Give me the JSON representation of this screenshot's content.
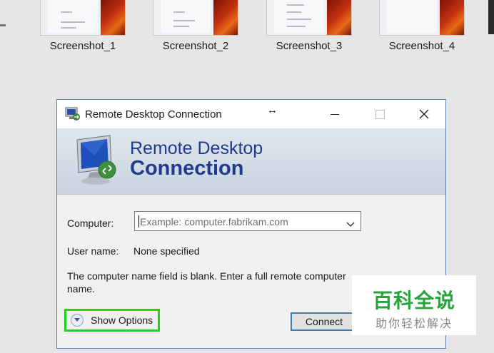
{
  "explorer": {
    "thumbnails": [
      {
        "name": "Screenshot_1"
      },
      {
        "name": "Screenshot_2"
      },
      {
        "name": "Screenshot_3"
      },
      {
        "name": "Screenshot_4"
      }
    ]
  },
  "dialog": {
    "title": "Remote Desktop Connection",
    "resize_cursor": "↔",
    "banner": {
      "line1": "Remote Desktop",
      "line2": "Connection"
    },
    "computer_label": "Computer:",
    "computer_placeholder": "Example: computer.fabrikam.com",
    "username_label": "User name:",
    "username_value": "None specified",
    "hint": "The computer name field is blank. Enter a full remote computer name.",
    "show_options": "Show Options",
    "connect": "Connect"
  },
  "watermark": {
    "title": "百科全说",
    "subtitle": "助你轻松解决"
  },
  "colors": {
    "banner_text": "#1f3b8b",
    "highlight": "#22d122",
    "watermark_green": "#27a43b"
  }
}
